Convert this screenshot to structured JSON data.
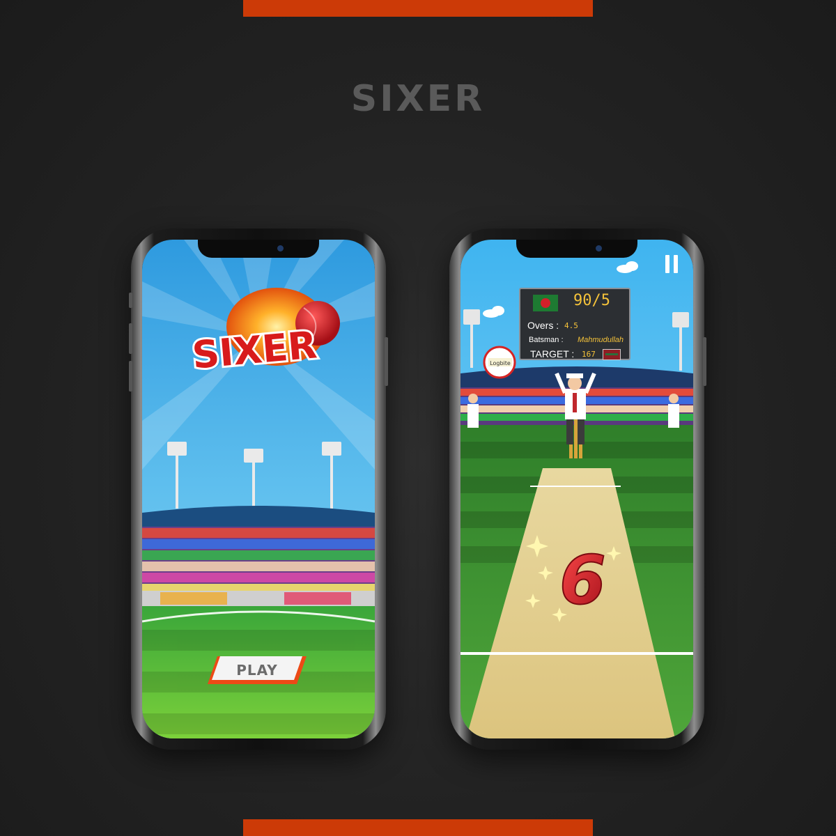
{
  "page": {
    "title": "SIXER",
    "accent_color": "#cc3a07"
  },
  "left_screen": {
    "logo_text": "SIXER",
    "play_button_label": "PLAY"
  },
  "right_screen": {
    "scoreboard": {
      "score": "90/5",
      "overs_label": "Overs :",
      "overs_value": "4.5",
      "batsman_label": "Batsman :",
      "batsman_value": "Mahmudullah",
      "target_label": "TARGET :",
      "target_value": "167"
    },
    "billboard_text": "Logbite",
    "big_number": "6",
    "pause_icon": "pause-icon"
  }
}
